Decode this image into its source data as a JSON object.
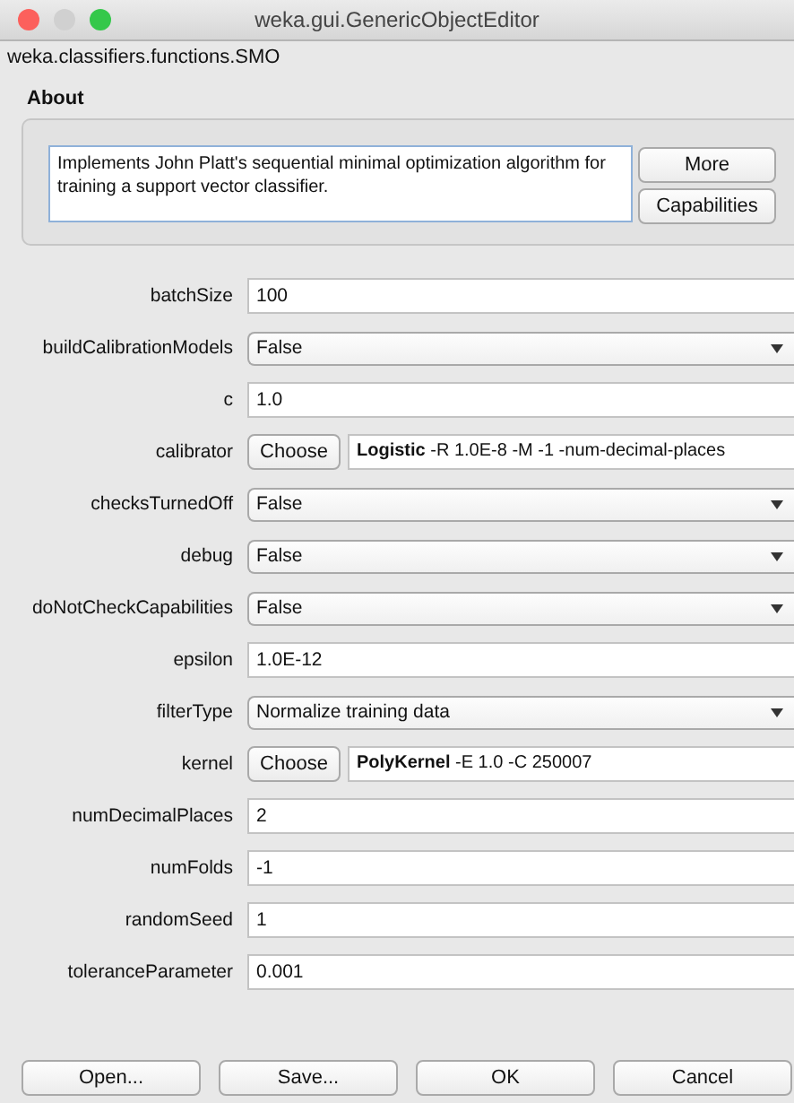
{
  "window": {
    "title": "weka.gui.GenericObjectEditor"
  },
  "class_name": "weka.classifiers.functions.SMO",
  "about": {
    "heading": "About",
    "text": "Implements John Platt's sequential minimal optimization algorithm for training a support vector classifier.",
    "buttons": [
      "More",
      "Capabilities"
    ]
  },
  "parameters": [
    {
      "kind": "text",
      "label": "batchSize",
      "value": "100"
    },
    {
      "kind": "dropdown",
      "label": "buildCalibrationModels",
      "value": "False"
    },
    {
      "kind": "text",
      "label": "c",
      "value": "1.0"
    },
    {
      "kind": "chooser",
      "label": "calibrator",
      "button": "Choose",
      "value": "**Logistic** -R 1.0E-8 -M -1 -num-decimal-places"
    },
    {
      "kind": "dropdown",
      "label": "checksTurnedOff",
      "value": "False"
    },
    {
      "kind": "dropdown",
      "label": "debug",
      "value": "False"
    },
    {
      "kind": "dropdown",
      "label": "doNotCheckCapabilities",
      "value": "False"
    },
    {
      "kind": "text",
      "label": "epsilon",
      "value": "1.0E-12"
    },
    {
      "kind": "dropdown",
      "label": "filterType",
      "value": "Normalize training data"
    },
    {
      "kind": "chooser",
      "label": "kernel",
      "button": "Choose",
      "value": "**PolyKernel** -E 1.0 -C 250007"
    },
    {
      "kind": "text",
      "label": "numDecimalPlaces",
      "value": "2"
    },
    {
      "kind": "text",
      "label": "numFolds",
      "value": "-1"
    },
    {
      "kind": "text",
      "label": "randomSeed",
      "value": "1"
    },
    {
      "kind": "text",
      "label": "toleranceParameter",
      "value": "0.001"
    }
  ],
  "buttons": [
    "Open...",
    "Save...",
    "OK",
    "Cancel"
  ]
}
